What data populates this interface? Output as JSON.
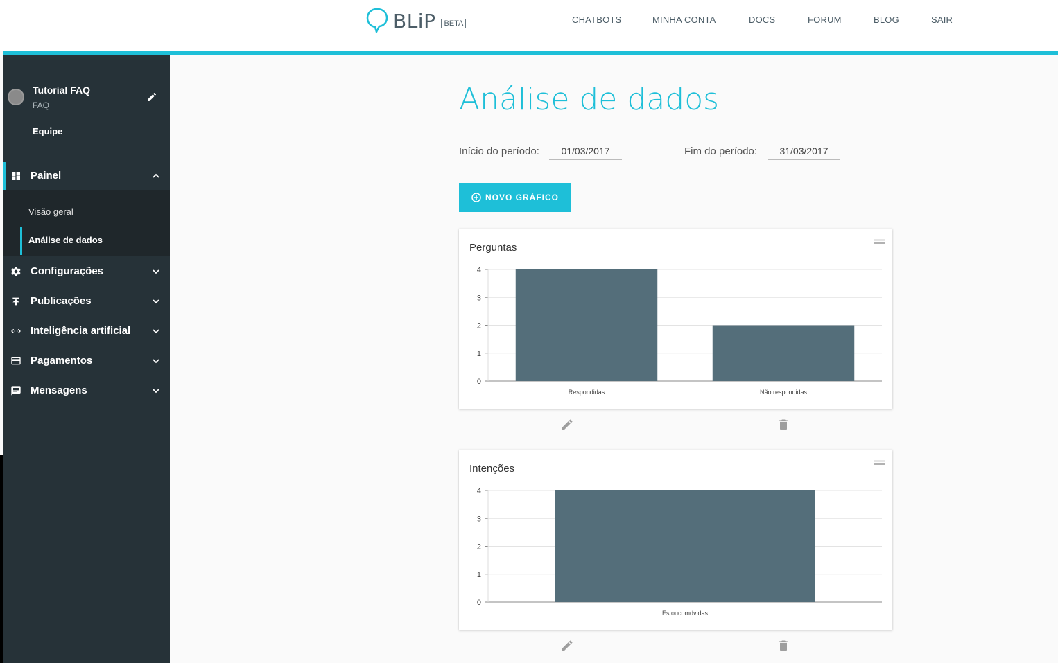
{
  "header": {
    "logo_text": "BLiP",
    "beta_label": "BETA",
    "nav": [
      {
        "label": "CHATBOTS"
      },
      {
        "label": "MINHA CONTA"
      },
      {
        "label": "DOCS"
      },
      {
        "label": "FORUM"
      },
      {
        "label": "BLOG"
      },
      {
        "label": "SAIR"
      }
    ]
  },
  "sidebar": {
    "bot_name": "Tutorial FAQ",
    "bot_subtitle": "FAQ",
    "team_label": "Equipe",
    "painel": {
      "label": "Painel",
      "subitems": [
        {
          "label": "Visão geral"
        },
        {
          "label": "Análise de dados"
        }
      ]
    },
    "menu": [
      {
        "label": "Configurações",
        "icon": "gear-icon"
      },
      {
        "label": "Publicações",
        "icon": "publish-icon"
      },
      {
        "label": "Inteligência artificial",
        "icon": "code-arrows-icon"
      },
      {
        "label": "Pagamentos",
        "icon": "credit-card-icon"
      },
      {
        "label": "Mensagens",
        "icon": "message-icon"
      }
    ]
  },
  "main": {
    "title": "Análise de dados",
    "period_start_label": "Início do período:",
    "period_start_value": "01/03/2017",
    "period_end_label": "Fim do período:",
    "period_end_value": "31/03/2017",
    "new_chart_label": "NOVO GRÁFICO"
  },
  "colors": {
    "accent": "#1ebfd8",
    "sidebar": "#263238",
    "bar": "#546e7a"
  },
  "chart_data": [
    {
      "type": "bar",
      "title": "Perguntas",
      "categories": [
        "Respondidas",
        "Não respondidas"
      ],
      "values": [
        4,
        2
      ],
      "ylim": [
        0,
        4
      ],
      "yticks": [
        0,
        1,
        2,
        3,
        4
      ],
      "grid": true
    },
    {
      "type": "bar",
      "title": "Intenções",
      "categories": [
        "Estoucomdvidas"
      ],
      "values": [
        4
      ],
      "ylim": [
        0,
        4
      ],
      "yticks": [
        0,
        1,
        2,
        3,
        4
      ],
      "grid": true
    }
  ]
}
